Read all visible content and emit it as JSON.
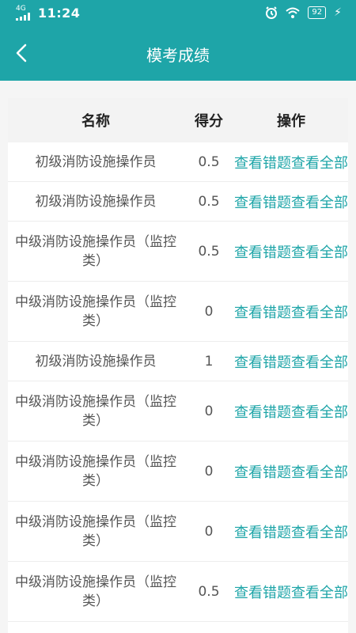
{
  "status_bar": {
    "network": "4G",
    "time": "11:24",
    "battery": "92"
  },
  "header": {
    "title": "模考成绩"
  },
  "table": {
    "headers": {
      "name": "名称",
      "score": "得分",
      "actions": "操作"
    },
    "rows": [
      {
        "name": "初级消防设施操作员",
        "score": "0.5",
        "view_wrong": "查看错题",
        "view_all": "查看全部"
      },
      {
        "name": "初级消防设施操作员",
        "score": "0.5",
        "view_wrong": "查看错题",
        "view_all": "查看全部"
      },
      {
        "name": "中级消防设施操作员（监控类）",
        "score": "0.5",
        "view_wrong": "查看错题",
        "view_all": "查看全部"
      },
      {
        "name": "中级消防设施操作员（监控类）",
        "score": "0",
        "view_wrong": "查看错题",
        "view_all": "查看全部"
      },
      {
        "name": "初级消防设施操作员",
        "score": "1",
        "view_wrong": "查看错题",
        "view_all": "查看全部"
      },
      {
        "name": "中级消防设施操作员（监控类）",
        "score": "0",
        "view_wrong": "查看错题",
        "view_all": "查看全部"
      },
      {
        "name": "中级消防设施操作员（监控类）",
        "score": "0",
        "view_wrong": "查看错题",
        "view_all": "查看全部"
      },
      {
        "name": "中级消防设施操作员（监控类）",
        "score": "0",
        "view_wrong": "查看错题",
        "view_all": "查看全部"
      },
      {
        "name": "中级消防设施操作员（监控类）",
        "score": "0.5",
        "view_wrong": "查看错题",
        "view_all": "查看全部"
      }
    ]
  },
  "colors": {
    "accent": "#1ea5a8",
    "background": "#f5f5f5"
  },
  "icons": {
    "back": "chevron-left-icon",
    "signal": "signal-icon",
    "wifi": "wifi-icon",
    "alarm": "alarm-icon",
    "battery": "battery-icon",
    "charging": "charging-bolt-icon"
  }
}
